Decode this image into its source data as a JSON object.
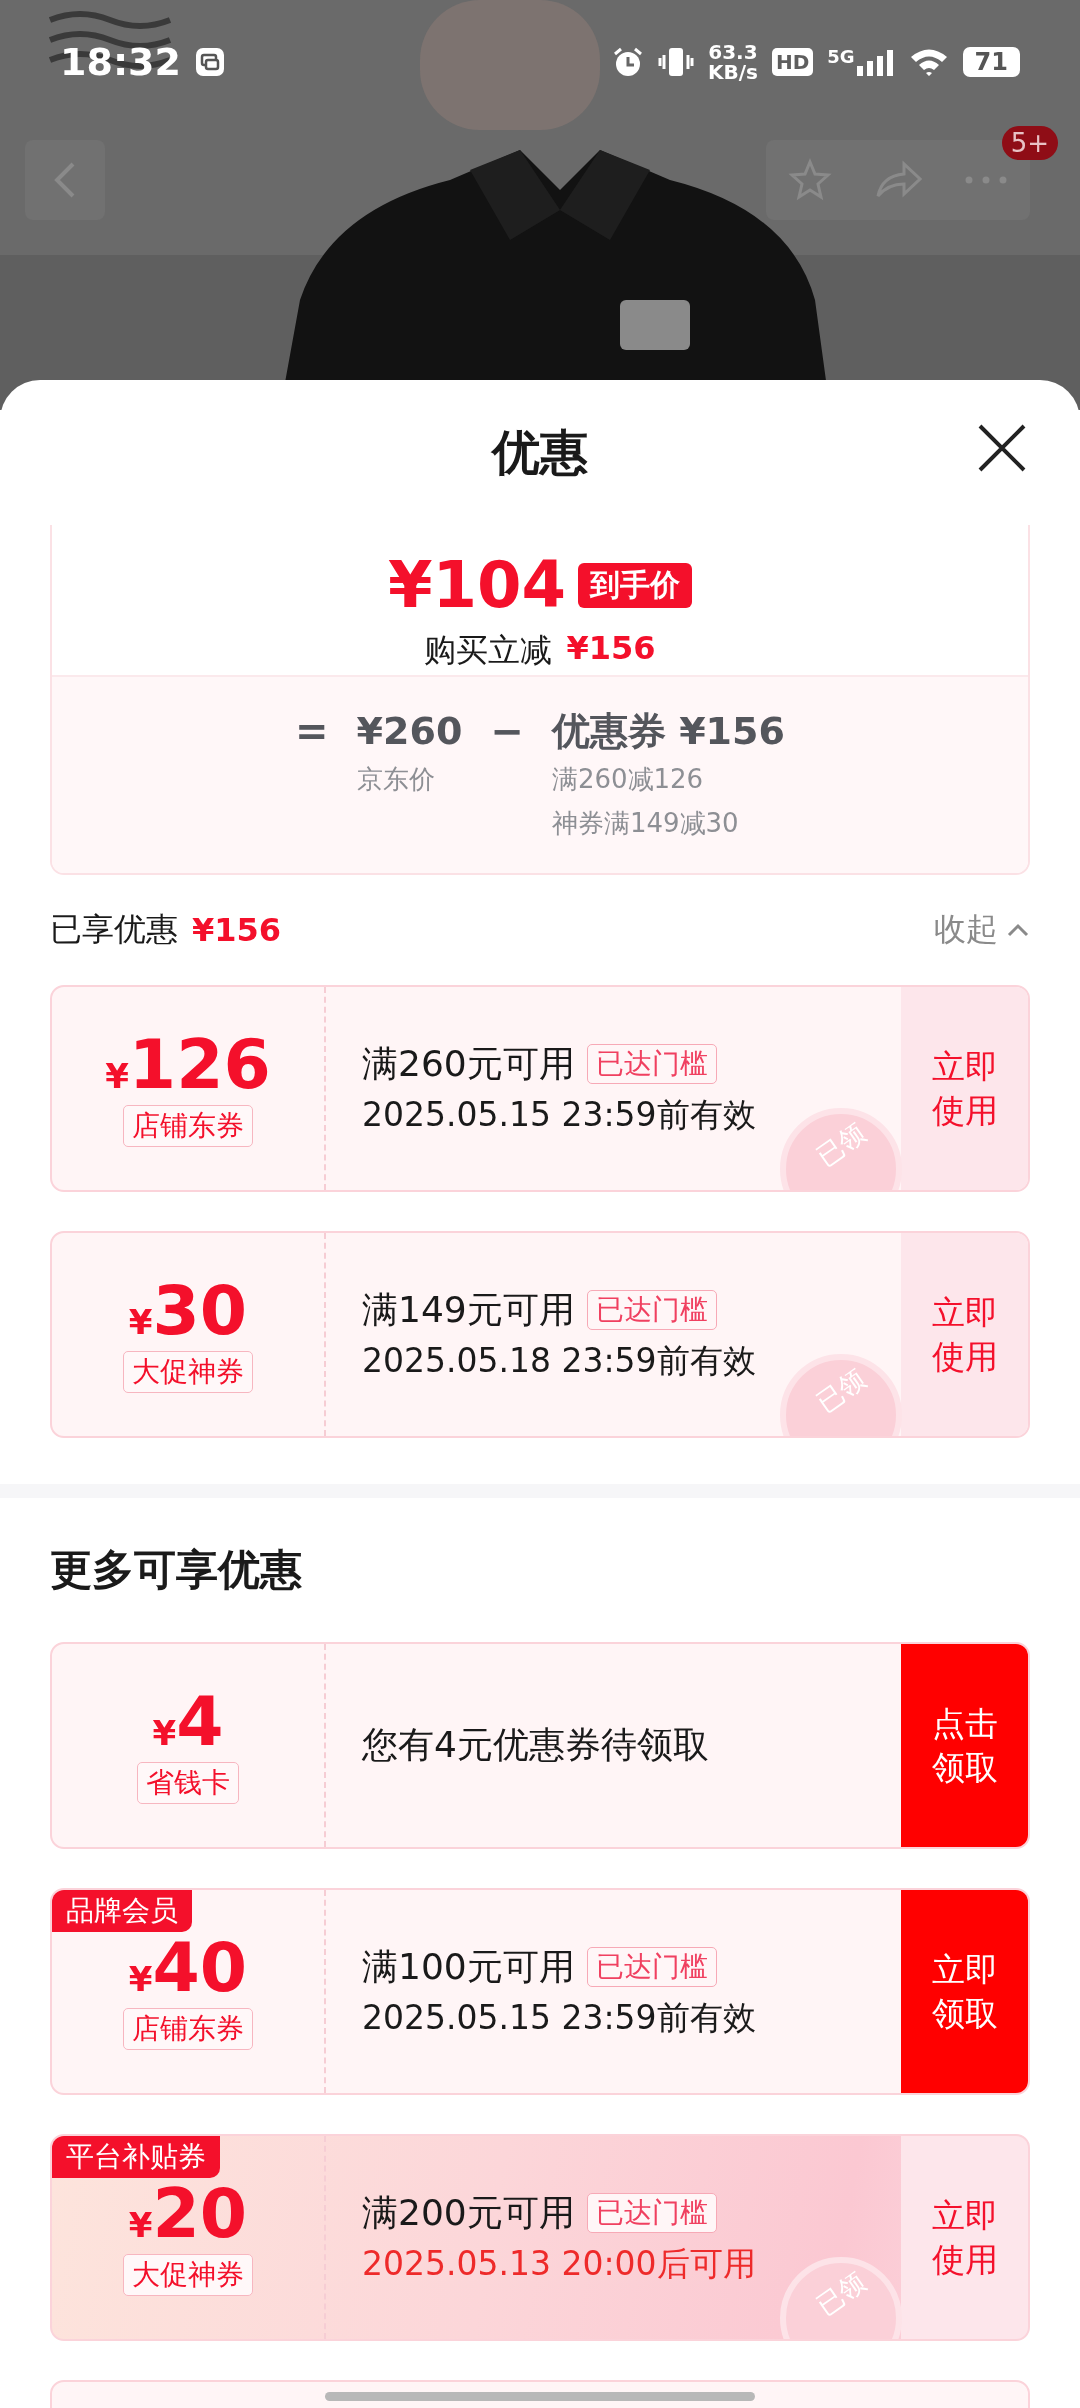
{
  "status_bar": {
    "time": "18:32",
    "net_speed": "63.3",
    "net_speed_unit": "KB/s",
    "hd": "HD",
    "network": "5G",
    "battery": "71"
  },
  "nav": {
    "badge": "5+"
  },
  "sheet": {
    "title": "优惠"
  },
  "price_summary": {
    "final_price": "¥104",
    "final_label": "到手价",
    "instant_discount_label": "购买立减",
    "instant_discount": "¥156",
    "equals": "=",
    "original_price": "¥260",
    "original_label": "京东价",
    "minus": "−",
    "coupon_label": "优惠券",
    "coupon_total": "¥156",
    "details": [
      "满260减126",
      "神券满149减30"
    ]
  },
  "applied": {
    "label": "已享优惠",
    "amount": "¥156",
    "toggle": "收起",
    "expanded": true
  },
  "applied_coupons": [
    {
      "kind": "threshold",
      "currency": "¥",
      "amount": "126",
      "tag": "店铺东券",
      "condition": "满260元可用",
      "badge": "已达门槛",
      "validity": "2025.05.15 23:59前有效",
      "validity_alert": false,
      "action": "立即使用",
      "claimed": true,
      "stamp": "已领",
      "highlighted": false
    },
    {
      "kind": "threshold",
      "currency": "¥",
      "amount": "30",
      "tag": "大促神券",
      "condition": "满149元可用",
      "badge": "已达门槛",
      "validity": "2025.05.18 23:59前有效",
      "validity_alert": false,
      "action": "立即使用",
      "claimed": true,
      "stamp": "已领",
      "highlighted": false
    }
  ],
  "more": {
    "title": "更多可享优惠",
    "coupons": [
      {
        "kind": "notice",
        "currency": "¥",
        "amount": "4",
        "tag": "省钱卡",
        "message": "您有4元优惠券待领取",
        "action": "点击领取",
        "claimed": false,
        "highlighted": false
      },
      {
        "kind": "threshold",
        "corner_label": "品牌会员",
        "currency": "¥",
        "amount": "40",
        "tag": "店铺东券",
        "condition": "满100元可用",
        "badge": "已达门槛",
        "validity": "2025.05.15 23:59前有效",
        "validity_alert": false,
        "action": "立即领取",
        "claimed": false,
        "highlighted": false
      },
      {
        "kind": "threshold",
        "corner_label": "平台补贴券",
        "currency": "¥",
        "amount": "20",
        "tag": "大促神券",
        "condition": "满200元可用",
        "badge": "已达门槛",
        "validity": "2025.05.13 20:00后可用",
        "validity_alert": true,
        "action": "立即使用",
        "claimed": true,
        "stamp": "已领",
        "highlighted": true
      }
    ]
  }
}
